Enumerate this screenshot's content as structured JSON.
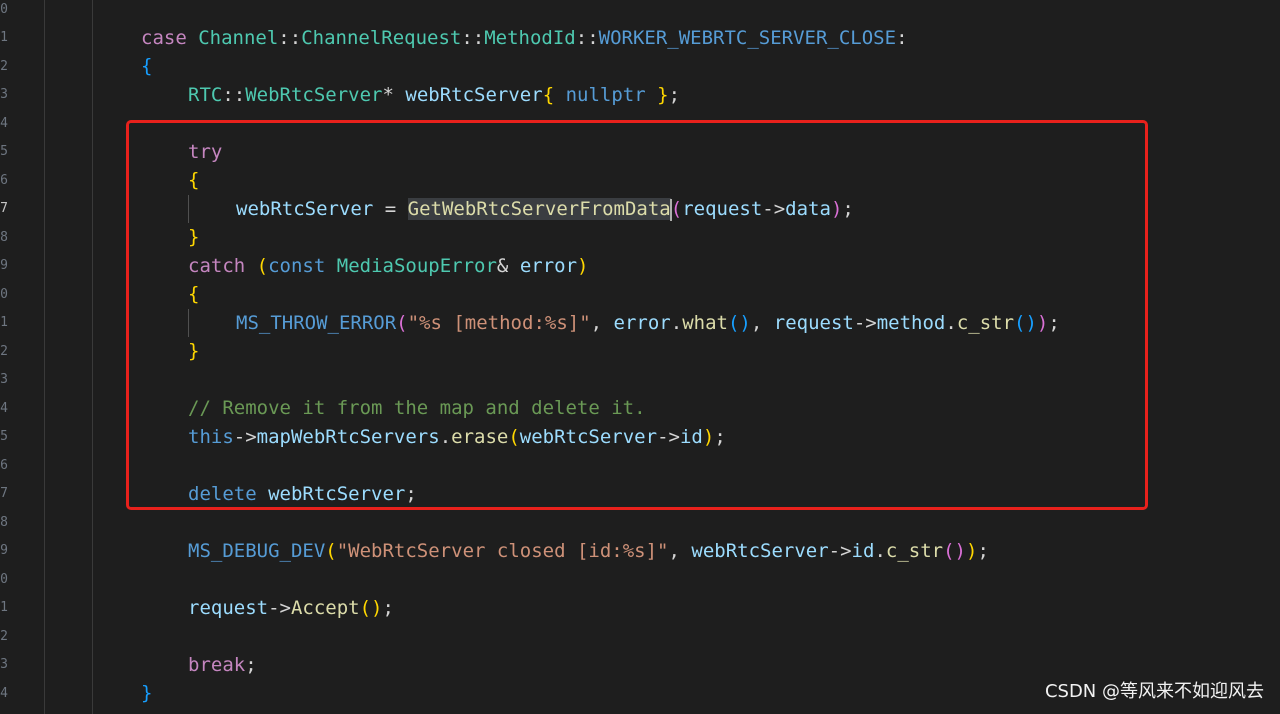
{
  "editor": {
    "line_numbers": [
      "0",
      "1",
      "2",
      "3",
      "4",
      "5",
      "6",
      "7",
      "8",
      "9",
      "0",
      "1",
      "2",
      "3",
      "4",
      "5",
      "6",
      "7",
      "8",
      "9",
      "0",
      "1",
      "2",
      "3",
      "4"
    ],
    "lines": {
      "case_line": {
        "kw_case": "case",
        "ns_channel": "Channel",
        "sep1": "::",
        "cls_channel_request": "ChannelRequest",
        "sep2": "::",
        "enum_method_id": "MethodId",
        "sep3": "::",
        "const_close": "WORKER_WEBRTC_SERVER_CLOSE",
        "colon": ":"
      },
      "open_brace_outer": "{",
      "decl_line": {
        "ns_rtc": "RTC",
        "sep": "::",
        "type_webrtc_server": "WebRtcServer",
        "ptr": "*",
        "var": "webRtcServer",
        "brace_open": "{",
        "nullptr": "nullptr",
        "brace_close": "}",
        "semi": ";"
      },
      "try_kw": "try",
      "try_open": "{",
      "assign_line": {
        "lhs": "webRtcServer",
        "eq": "=",
        "fn_selected": "GetWebRtcServerFromData",
        "paren_open": "(",
        "arg_request": "request",
        "arrow": "->",
        "arg_data": "data",
        "paren_close": ")",
        "semi": ";"
      },
      "try_close": "}",
      "catch_line": {
        "kw_catch": "catch",
        "paren_open": "(",
        "kw_const": "const",
        "type_error": "MediaSoupError",
        "amp": "&",
        "var_error": "error",
        "paren_close": ")"
      },
      "catch_open": "{",
      "throw_line": {
        "macro": "MS_THROW_ERROR",
        "paren_open": "(",
        "format_string": "\"%s [method:%s]\"",
        "comma1": ",",
        "var_error": "error",
        "dot1": ".",
        "fn_what": "what",
        "what_parens": "()",
        "comma2": ",",
        "var_request": "request",
        "arrow": "->",
        "var_method": "method",
        "dot2": ".",
        "fn_cstr": "c_str",
        "cstr_parens": "()",
        "paren_close": ")",
        "semi": ";"
      },
      "catch_close": "}",
      "comment": "// Remove it from the map and delete it.",
      "erase_line": {
        "kw_this": "this",
        "arrow1": "->",
        "var_map": "mapWebRtcServers",
        "dot": ".",
        "fn_erase": "erase",
        "paren_open": "(",
        "var_server": "webRtcServer",
        "arrow2": "->",
        "var_id": "id",
        "paren_close": ")",
        "semi": ";"
      },
      "delete_line": {
        "kw_delete": "delete",
        "var": "webRtcServer",
        "semi": ";"
      },
      "debug_line": {
        "macro": "MS_DEBUG_DEV",
        "paren_open": "(",
        "format_string": "\"WebRtcServer closed [id:%s]\"",
        "comma": ",",
        "var_server": "webRtcServer",
        "arrow": "->",
        "var_id": "id",
        "dot": ".",
        "fn_cstr": "c_str",
        "cstr_parens": "()",
        "paren_close": ")",
        "semi": ";"
      },
      "accept_line": {
        "var_request": "request",
        "arrow": "->",
        "fn_accept": "Accept",
        "parens": "()",
        "semi": ";"
      },
      "break_line": {
        "kw_break": "break",
        "semi": ";"
      },
      "close_brace_outer": "}"
    }
  },
  "annotation": {
    "box_color": "#e8211c"
  },
  "watermark": "CSDN @等风来不如迎风去"
}
